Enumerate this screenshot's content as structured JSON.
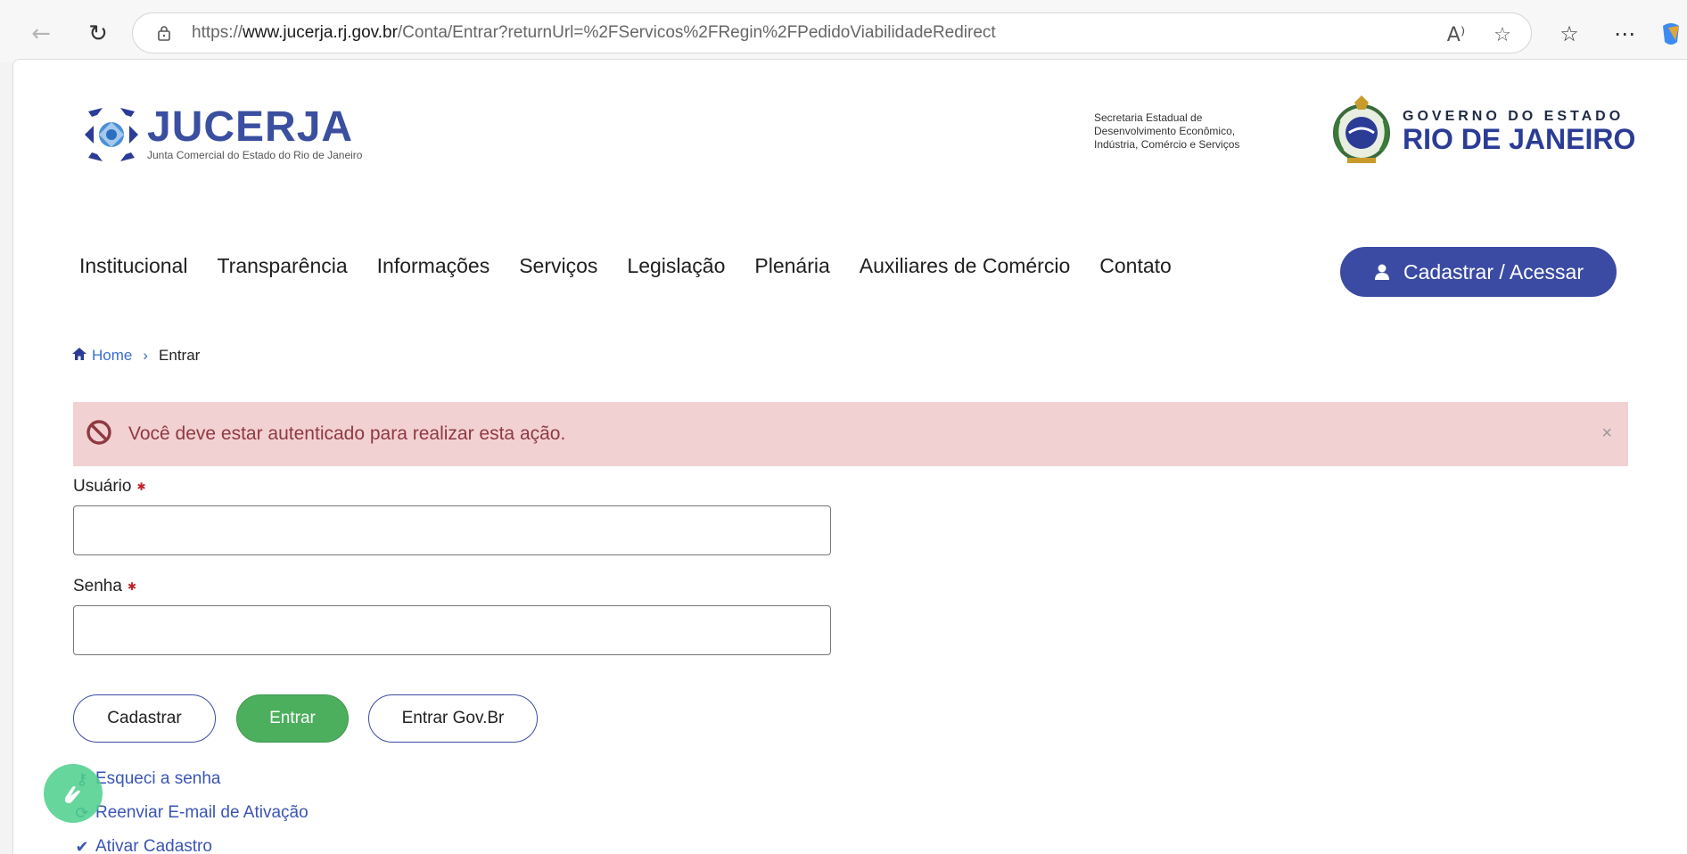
{
  "browser": {
    "url_prefix": "https://",
    "url_domain": "www.jucerja.rj.gov.br",
    "url_path": "/Conta/Entrar?returnUrl=%2FServicos%2FRegin%2FPedidoViabilidadeRedirect",
    "read_aloud_label": "A⁾"
  },
  "header": {
    "logo_title": "JUCERJA",
    "logo_subtitle": "Junta Comercial do Estado do Rio de Janeiro",
    "secretaria": [
      "Secretaria Estadual de",
      "Desenvolvimento Econômico,",
      "Indústria, Comércio e Serviços"
    ],
    "gov_line1": "GOVERNO DO ESTADO",
    "gov_line2": "RIO DE JANEIRO"
  },
  "menu": {
    "items": [
      "Institucional",
      "Transparência",
      "Informações",
      "Serviços",
      "Legislação",
      "Plenária",
      "Auxiliares de Comércio",
      "Contato"
    ],
    "cta_label": "Cadastrar / Acessar"
  },
  "breadcrumb": {
    "home": "Home",
    "current": "Entrar"
  },
  "alert": {
    "message": "Você deve estar autenticado para realizar esta ação.",
    "close": "×"
  },
  "form": {
    "user_label": "Usuário",
    "user_value": "",
    "password_label": "Senha",
    "password_value": "",
    "required_mark": "✱"
  },
  "buttons": {
    "register": "Cadastrar",
    "login": "Entrar",
    "govbr": "Entrar Gov.Br"
  },
  "links": {
    "forgot": "Esqueci a senha",
    "resend": "Reenviar E-mail de Ativação",
    "activate": "Ativar Cadastro"
  },
  "colors": {
    "primary": "#3b4ba3",
    "success": "#4caf5d",
    "alert_bg": "#f2d1d3",
    "alert_text": "#8f3941"
  }
}
